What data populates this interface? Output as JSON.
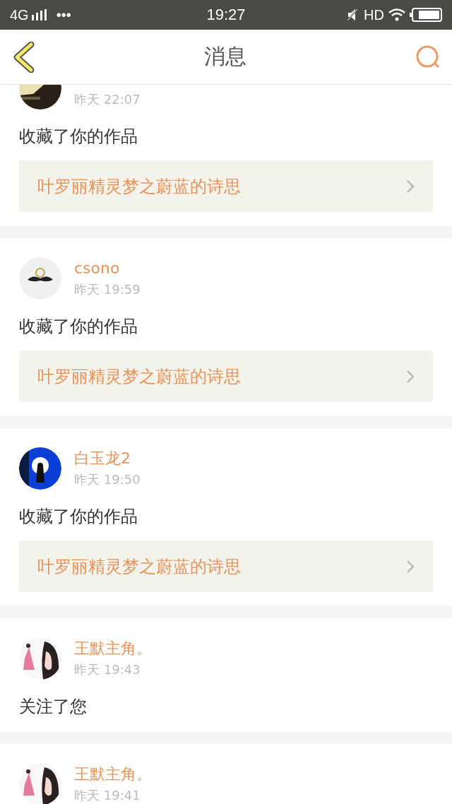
{
  "status_bar": {
    "network": "4G",
    "dots": "•••",
    "time": "19:27",
    "hd": "HD"
  },
  "nav": {
    "title": "消息"
  },
  "messages": [
    {
      "time": "昨天 22:07",
      "action": "收藏了你的作品",
      "link": "叶罗丽精灵梦之蔚蓝的诗思"
    },
    {
      "name": "csono",
      "time": "昨天 19:59",
      "action": "收藏了你的作品",
      "link": "叶罗丽精灵梦之蔚蓝的诗思"
    },
    {
      "name": "白玉龙2",
      "time": "昨天 19:50",
      "action": "收藏了你的作品",
      "link": "叶罗丽精灵梦之蔚蓝的诗思"
    },
    {
      "name": "王默主角。",
      "time": "昨天 19:43",
      "action": "关注了您"
    },
    {
      "name": "王默主角。",
      "time": "昨天 19:41"
    }
  ]
}
